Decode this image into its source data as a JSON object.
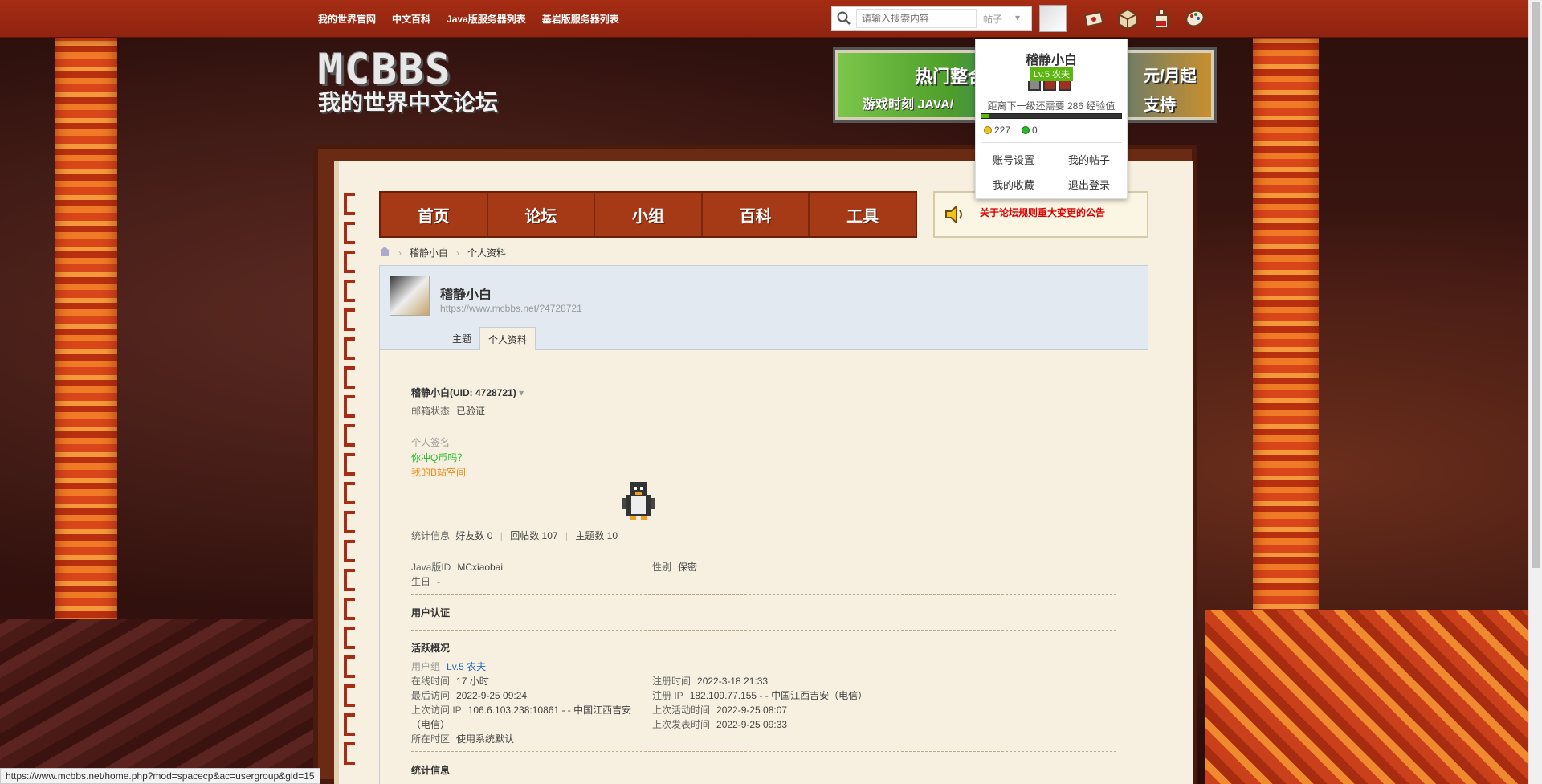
{
  "topnav": [
    "我的世界官网",
    "中文百科",
    "Java版服务器列表",
    "基岩版服务器列表"
  ],
  "search": {
    "placeholder": "请输入搜索内容",
    "scope": "帖子"
  },
  "logo": {
    "big": "MCBBS",
    "small": "我的世界中文论坛"
  },
  "banner": {
    "a": "热门整合",
    "b": "游戏时刻 JAVA/",
    "c": "元/月起",
    "d": "支持"
  },
  "mainnav": [
    "首页",
    "论坛",
    "小组",
    "百科",
    "工具"
  ],
  "notice": "关于论坛规则重大变更的公告",
  "breadcrumb": [
    "稽静小白",
    "个人资料"
  ],
  "profile": {
    "name": "稽静小白",
    "url": "https://www.mcbbs.net/?4728721",
    "tabs": [
      "主题",
      "个人资料"
    ]
  },
  "detail": {
    "name_uid": "稽静小白(UID: 4728721)",
    "email_label": "邮箱状态",
    "email_value": "已验证",
    "sig_label": "个人签名",
    "sig_line1": "你冲Q币吗？",
    "sig_line2": "我的B站空间",
    "stats_label": "统计信息",
    "friends": "好友数 0",
    "replies": "回帖数 107",
    "threads": "主题数 10",
    "java_id_label": "Java版ID",
    "java_id": "MCxiaobai",
    "gender_label": "性别",
    "gender": "保密",
    "birthday_label": "生日",
    "birthday": "-",
    "auth_title": "用户认证",
    "active_title": "活跃概况",
    "group_label": "用户组",
    "group": "Lv.5 农夫",
    "online_label": "在线时间",
    "online": "17 小时",
    "reg_time_label": "注册时间",
    "reg_time": "2022-3-18 21:33",
    "last_visit_label": "最后访问",
    "last_visit": "2022-9-25 09:24",
    "reg_ip_label": "注册 IP",
    "reg_ip": "182.109.77.155 - - 中国江西吉安（电信）",
    "last_ip_label": "上次访问 IP",
    "last_ip": "106.6.103.238:10861 - - 中国江西吉安",
    "last_ip2": "（电信）",
    "last_active_label": "上次活动时间",
    "last_active": "2022-9-25 08:07",
    "last_post_label": "上次发表时间",
    "last_post": "2022-9-25 09:33",
    "tz_label": "所在时区",
    "tz": "使用系统默认",
    "stats_title": "统计信息"
  },
  "dropdown": {
    "name": "稽静小白",
    "level": "Lv.5 农夫",
    "exp_text": "距离下一级还需要 286 经验值",
    "exp_progress": 0.05,
    "gold": "227",
    "gem": "0",
    "menu": [
      "账号设置",
      "我的帖子",
      "我的收藏",
      "退出登录"
    ]
  },
  "statusbar": "https://www.mcbbs.net/home.php?mod=spacecp&ac=usergroup&gid=15"
}
